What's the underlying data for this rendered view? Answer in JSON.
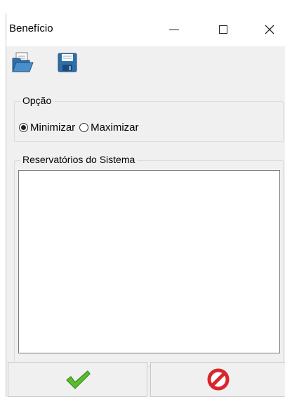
{
  "window": {
    "title": "Benefício"
  },
  "toolbar": {
    "open_icon": "folder-open-icon",
    "save_icon": "floppy-disk-icon"
  },
  "option_group": {
    "legend": "Opção",
    "options": [
      {
        "label": "Minimizar",
        "selected": true
      },
      {
        "label": "Maximizar",
        "selected": false
      }
    ]
  },
  "reservoirs_group": {
    "legend": "Reservatórios do Sistema",
    "items": []
  },
  "buttons": {
    "ok_icon": "green-checkmark-icon",
    "cancel_icon": "red-cancel-icon"
  },
  "colors": {
    "ok_green": "#4caf2a",
    "cancel_red": "#d8262c",
    "folder_blue": "#3a7fb8"
  }
}
